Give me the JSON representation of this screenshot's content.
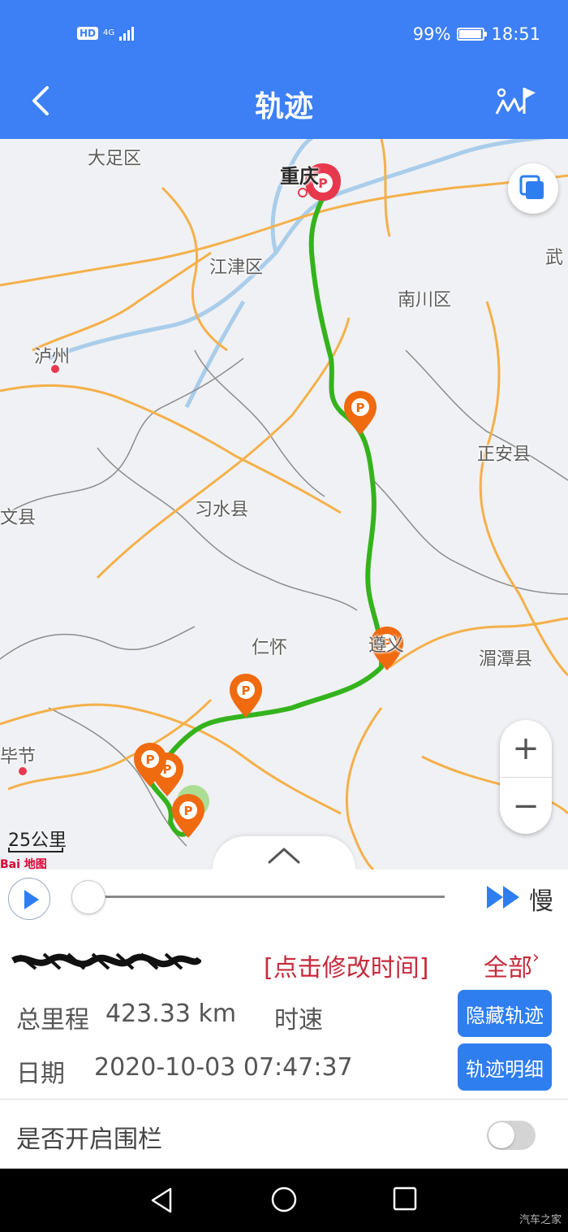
{
  "status_bar": {
    "hd": "HD",
    "network": "4G",
    "battery": "99%",
    "time": "18:51"
  },
  "app_bar": {
    "title": "轨迹",
    "back_icon": "chevron-left-icon",
    "track_icon": "route-flag-icon"
  },
  "map": {
    "labels": {
      "dazu": "大足区",
      "chongqing": "重庆",
      "jiangjin": "江津区",
      "wulong": "武",
      "nanchuan": "南川区",
      "luzhou": "泸州",
      "zhengan": "正安县",
      "xishui": "习水县",
      "wen": "文县",
      "renhuai": "仁怀",
      "zunyi": "遵义",
      "meitan": "湄潭县",
      "bijie": "毕节"
    },
    "scale": "25公里",
    "logo": "Bai 地图",
    "zoom_in": "+",
    "zoom_out": "−",
    "expand_icon": "chevron-up-icon",
    "route_color": "#34b31c",
    "parking_marker_color": "#f06a10",
    "start_marker_color": "#e8384d"
  },
  "player": {
    "speed_label": "慢",
    "progress": 0
  },
  "info": {
    "plate": "",
    "edit_time_link": "[点击修改时间]",
    "all_link": "全部",
    "all_chevron": "›",
    "mileage_label": "总里程",
    "mileage_value": "423.33 km",
    "speed_label": "时速",
    "date_label": "日期",
    "date_value": "2020-10-03 07:47:37",
    "hide_track_button": "隐藏轨迹",
    "track_detail_button": "轨迹明细"
  },
  "fence": {
    "label": "是否开启围栏",
    "enabled": false
  },
  "watermark": "汽车之家",
  "colors": {
    "accent": "#3d7ff5",
    "button": "#2e7ef0",
    "link_red": "#c62b3c"
  }
}
